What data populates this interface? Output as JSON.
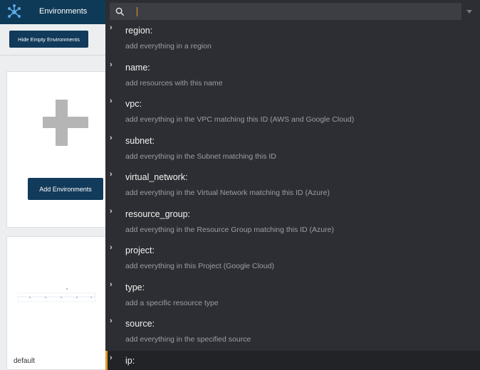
{
  "header": {
    "title": "Environments"
  },
  "left": {
    "hide_empty_label": "Hide Empty Environments",
    "add_env_label": "Add Environments",
    "default_card_label": "default"
  },
  "search": {
    "value": "",
    "placeholder": ""
  },
  "options": [
    {
      "key": "region:",
      "desc": "add everything in a region"
    },
    {
      "key": "name:",
      "desc": "add resources with this name"
    },
    {
      "key": "vpc:",
      "desc": "add everything in the VPC matching this ID (AWS and Google Cloud)"
    },
    {
      "key": "subnet:",
      "desc": "add everything in the Subnet matching this ID"
    },
    {
      "key": "virtual_network:",
      "desc": "add everything in the Virtual Network matching this ID (Azure)"
    },
    {
      "key": "resource_group:",
      "desc": "add everything in the Resource Group matching this ID (Azure)"
    },
    {
      "key": "project:",
      "desc": "add everything in this Project (Google Cloud)"
    },
    {
      "key": "type:",
      "desc": "add a specific resource type"
    },
    {
      "key": "source:",
      "desc": "add everything in the specified source"
    },
    {
      "key": "ip:",
      "desc": ""
    }
  ],
  "colors": {
    "accent": "#e39a2c",
    "navy": "#0f3a57",
    "panel": "#2d2e33"
  }
}
